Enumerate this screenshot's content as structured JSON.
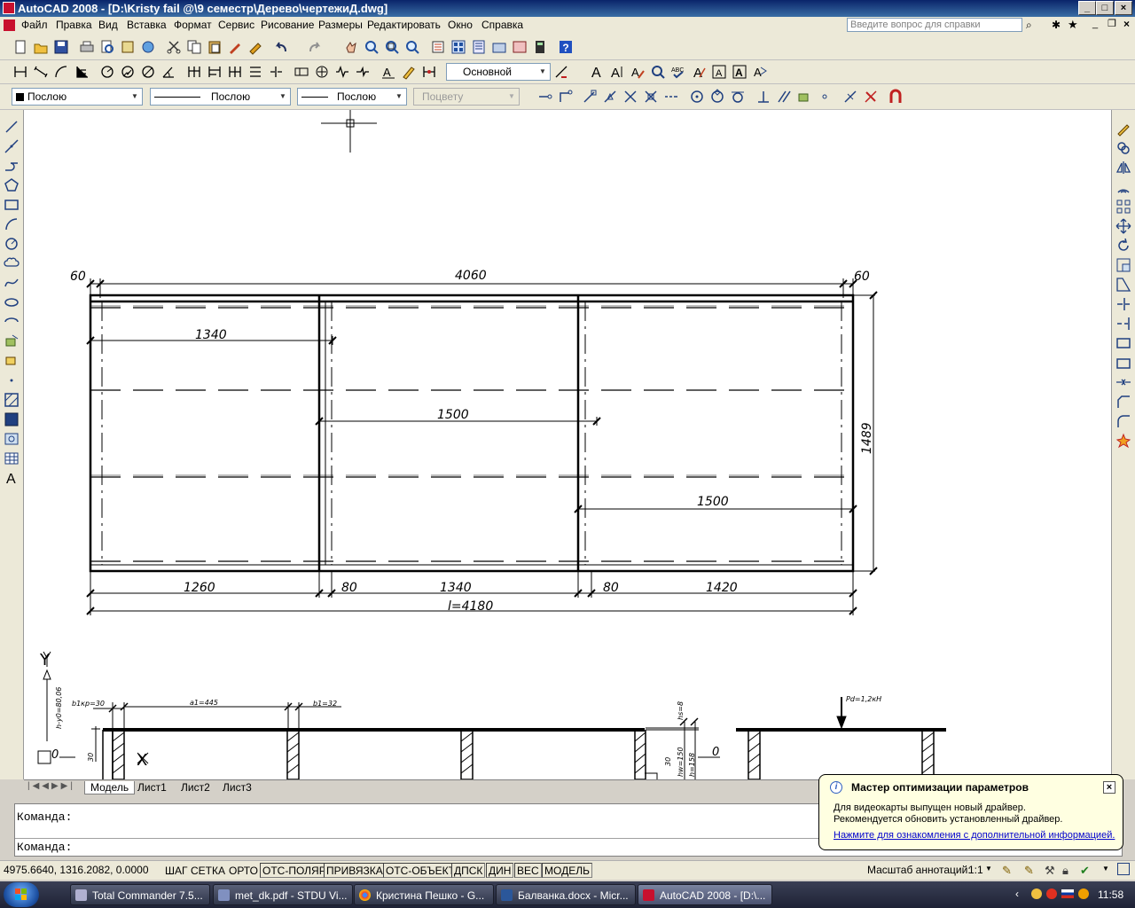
{
  "window": {
    "title": "AutoCAD 2008 - [D:\\Kristy fail @\\9 семестр\\Дерево\\чертежиД.dwg]"
  },
  "menu": {
    "items": [
      "Файл",
      "Правка",
      "Вид",
      "Вставка",
      "Формат",
      "Сервис",
      "Рисование",
      "Размеры",
      "Редактировать",
      "Окно",
      "Справка"
    ],
    "help_placeholder": "Введите вопрос для справки"
  },
  "styles": {
    "text_style": "Основной"
  },
  "properties": {
    "color": "Послою",
    "linetype": "Послою",
    "lineweight": "Послою",
    "plotstyle": "Поцвету"
  },
  "drawing": {
    "top_dims": {
      "left": "60",
      "middle": "4060",
      "right": "60"
    },
    "inner_dims": {
      "d1": "1340",
      "d2": "1500",
      "d3": "1500"
    },
    "side_dim": "1489",
    "bottom_dims": {
      "b1": "1260",
      "b2": "80",
      "b3": "1340",
      "b4": "80",
      "b5": "1420"
    },
    "overall": "l=4180",
    "section": {
      "axis_y": "Y",
      "axis_x": "X",
      "zero_left": "0",
      "zero_right": "0",
      "y0": "h-y0=80,06",
      "bkp": "b1кр=30",
      "a1": "a1=445",
      "b1": "b1=32",
      "hs": "hs=8",
      "v30a": "30",
      "v30b": "30",
      "h150": "hw=150",
      "h158": "h=158",
      "load": "Pd=1,2кН"
    }
  },
  "tabs": [
    "Модель",
    "Лист1",
    "Лист2",
    "Лист3"
  ],
  "command": {
    "line1": "Команда:",
    "line2": "Команда:"
  },
  "status": {
    "coords": "4975.6640, 1316.2082, 0.0000",
    "buttons": [
      "ШАГ",
      "СЕТКА",
      "ОРТО",
      "ОТС-ПОЛЯР",
      "ПРИВЯЗКА",
      "ОТС-ОБЪЕКТ",
      "ДПСК",
      "ДИН",
      "ВЕС",
      "МОДЕЛЬ"
    ],
    "annotation_label": "Масштаб аннотаций:",
    "annotation_value": "1:1"
  },
  "balloon": {
    "title": "Мастер оптимизации параметров",
    "line1": "Для видеокарты выпущен новый драйвер.",
    "line2": "Рекомендуется обновить установленный драйвер.",
    "link": "Нажмите для ознакомления с дополнительной информацией."
  },
  "taskbar": {
    "tasks": [
      "Total Commander 7.5...",
      "met_dk.pdf - STDU Vi...",
      "Кристина Пешко - G...",
      "Балванка.docx - Micr...",
      "AutoCAD 2008 - [D:\\..."
    ],
    "clock": "11:58"
  },
  "colors": {
    "accent": "#0a246a",
    "canvas": "#ffffff",
    "toolbar": "#ece9d8",
    "balloon": "#ffffe1"
  }
}
